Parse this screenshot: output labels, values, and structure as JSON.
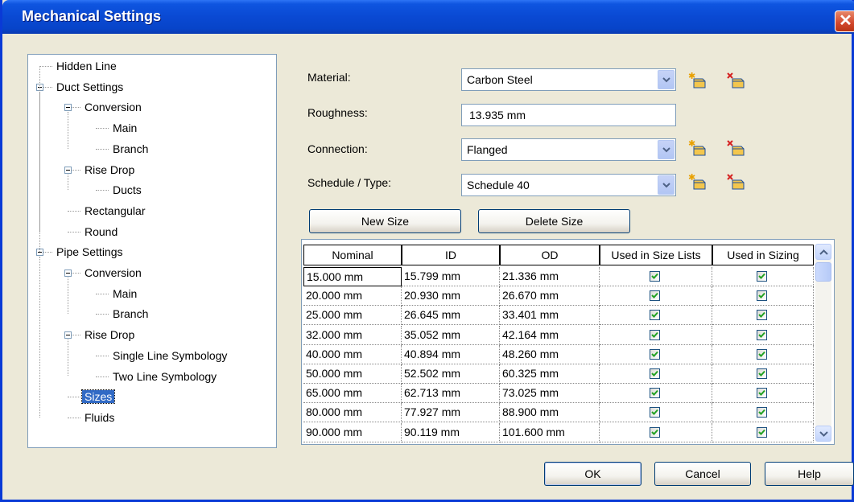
{
  "window": {
    "title": "Mechanical Settings"
  },
  "tree": {
    "items": [
      {
        "label": "Hidden Line"
      },
      {
        "label": "Duct Settings"
      },
      {
        "label": "Conversion"
      },
      {
        "label": "Main"
      },
      {
        "label": "Branch"
      },
      {
        "label": "Rise Drop"
      },
      {
        "label": "Ducts"
      },
      {
        "label": "Rectangular"
      },
      {
        "label": "Round"
      },
      {
        "label": "Pipe Settings"
      },
      {
        "label": "Conversion"
      },
      {
        "label": "Main"
      },
      {
        "label": "Branch"
      },
      {
        "label": "Rise Drop"
      },
      {
        "label": "Single Line Symbology"
      },
      {
        "label": "Two Line Symbology"
      },
      {
        "label": "Sizes"
      },
      {
        "label": "Fluids"
      }
    ],
    "selected": "Sizes"
  },
  "form": {
    "material_label": "Material:",
    "material_value": "Carbon Steel",
    "roughness_label": "Roughness:",
    "roughness_value": "13.935 mm",
    "connection_label": "Connection:",
    "connection_value": "Flanged",
    "schedule_label": "Schedule / Type:",
    "schedule_value": "Schedule 40"
  },
  "buttons": {
    "new_size": "New Size",
    "delete_size": "Delete Size",
    "ok": "OK",
    "cancel": "Cancel",
    "help": "Help"
  },
  "grid": {
    "headers": [
      "Nominal",
      "ID",
      "OD",
      "Used in Size Lists",
      "Used in Sizing"
    ],
    "rows": [
      [
        "15.000 mm",
        "15.799 mm",
        "21.336 mm"
      ],
      [
        "20.000 mm",
        "20.930 mm",
        "26.670 mm"
      ],
      [
        "25.000 mm",
        "26.645 mm",
        "33.401 mm"
      ],
      [
        "32.000 mm",
        "35.052 mm",
        "42.164 mm"
      ],
      [
        "40.000 mm",
        "40.894 mm",
        "48.260 mm"
      ],
      [
        "50.000 mm",
        "52.502 mm",
        "60.325 mm"
      ],
      [
        "65.000 mm",
        "62.713 mm",
        "73.025 mm"
      ],
      [
        "80.000 mm",
        "77.927 mm",
        "88.900 mm"
      ],
      [
        "90.000 mm",
        "90.119 mm",
        "101.600 mm"
      ]
    ],
    "checked_size_lists": [
      true,
      true,
      true,
      true,
      true,
      true,
      true,
      true,
      true
    ],
    "checked_sizing": [
      true,
      true,
      true,
      true,
      true,
      true,
      true,
      true,
      true
    ]
  },
  "colors": {
    "titlebar": "#0a49d3",
    "selection": "#316ac5",
    "checkmark": "#21a121"
  }
}
